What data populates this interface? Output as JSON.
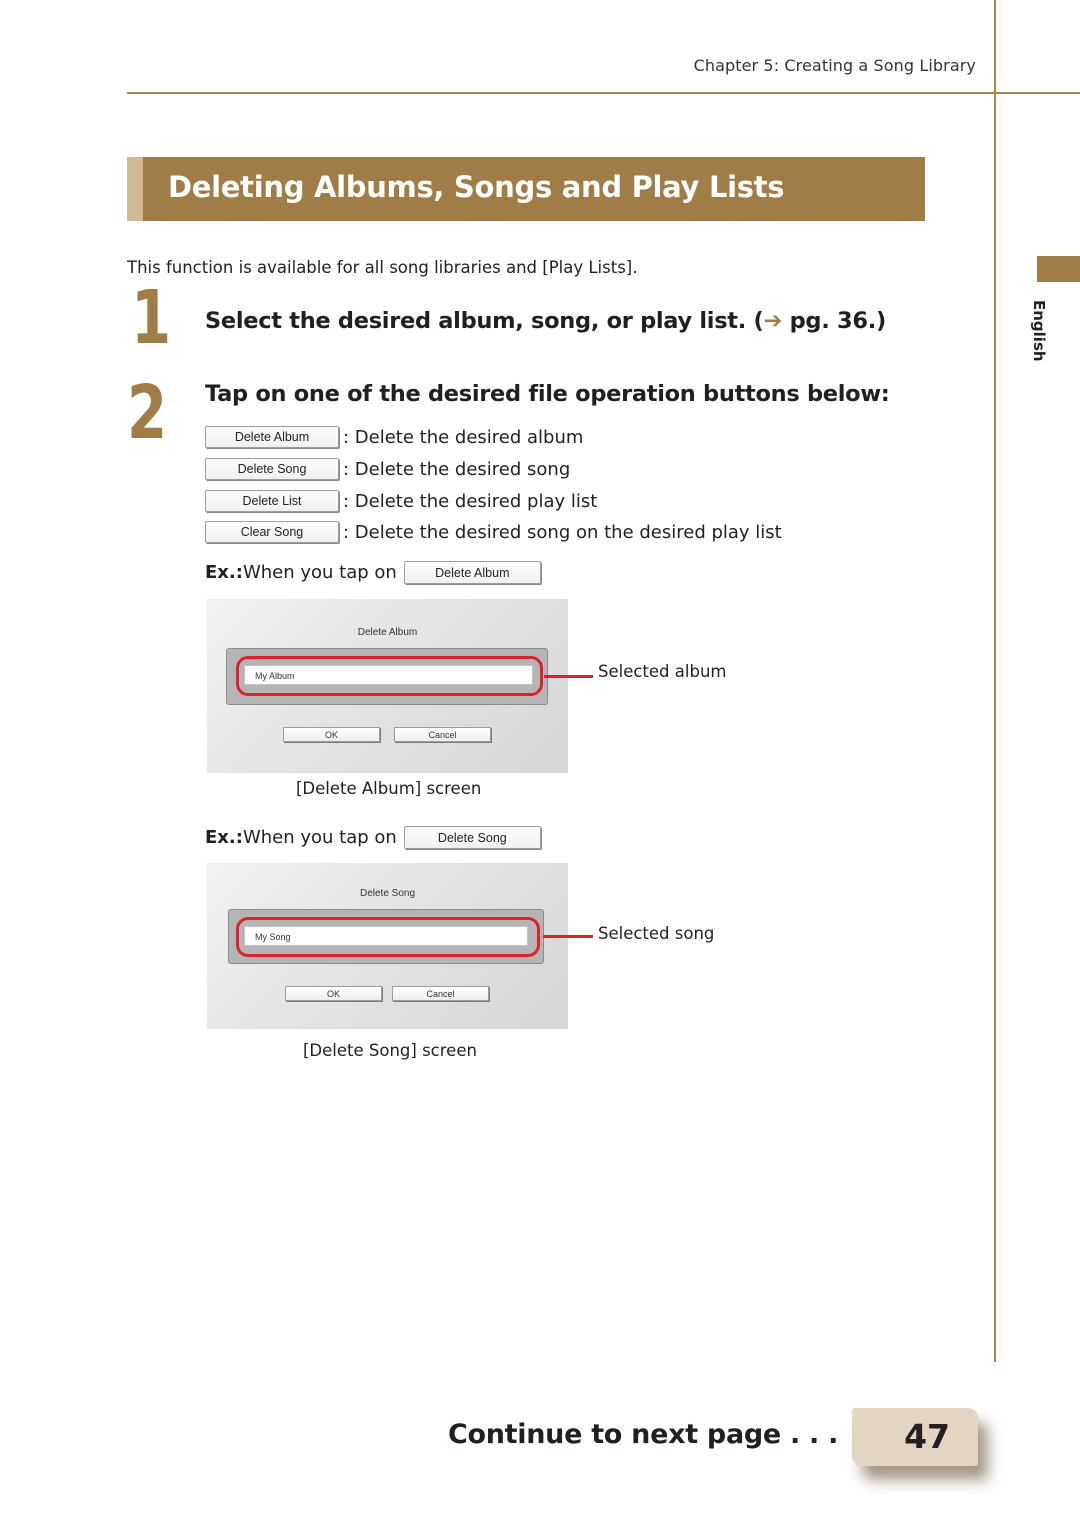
{
  "header": {
    "chapter": "Chapter 5: Creating a Song Library",
    "language_tab": "English"
  },
  "section": {
    "title": "Deleting Albums, Songs and Play Lists",
    "intro": "This function is available for all song libraries and [Play Lists]."
  },
  "steps": [
    {
      "number": "1",
      "text_before": "Select the desired album, song, or play list. (",
      "arrow": "➔",
      "text_after": " pg. 36.)"
    },
    {
      "number": "2",
      "text": "Tap on one of the desired file operation buttons below:"
    }
  ],
  "operations": [
    {
      "button": "Delete Album",
      "description": ": Delete the desired album"
    },
    {
      "button": "Delete Song",
      "description": ": Delete the desired song"
    },
    {
      "button": "Delete List",
      "description": ": Delete the desired play list"
    },
    {
      "button": "Clear Song",
      "description": ": Delete the desired song on the desired play list"
    }
  ],
  "examples": [
    {
      "prefix": "Ex.:",
      "text": " When you tap on",
      "button": "Delete Album",
      "screen_title": "Delete Album",
      "selected_item": "My Album",
      "ok": "OK",
      "cancel": "Cancel",
      "callout": "Selected album",
      "caption": "[Delete Album] screen"
    },
    {
      "prefix": "Ex.:",
      "text": " When you tap on",
      "button": "Delete Song",
      "screen_title": "Delete Song",
      "selected_item": "My Song",
      "ok": "OK",
      "cancel": "Cancel",
      "callout": "Selected song",
      "caption": "[Delete Song] screen"
    }
  ],
  "footer": {
    "continue": "Continue to next page . . .",
    "page_number": "47"
  },
  "colors": {
    "accent": "#a07c47",
    "highlight": "#e0202a"
  }
}
